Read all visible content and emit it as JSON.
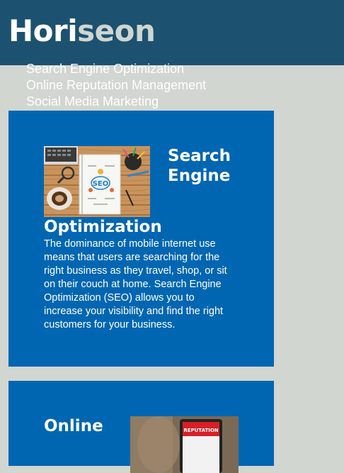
{
  "header": {
    "logo_part1": "Hori",
    "logo_part2": "seon"
  },
  "nav": {
    "items": [
      "Search Engine Optimization",
      "Online Reputation Management",
      "Social Media Marketing"
    ]
  },
  "sections": [
    {
      "title_line1": "Search Engine",
      "title_line2": "Optimization",
      "image_label": "SEO",
      "text": "The dominance of mobile internet use means that users are searching for the right business as they travel, shop, or sit on their couch at home. Search Engine Optimization (SEO) allows you to increase your visibility and find the right customers for your business."
    },
    {
      "title_line1": "Online",
      "image_label": "REPUTATION"
    }
  ],
  "colors": {
    "header_bg": "#1c5170",
    "page_bg": "#d2d6d0",
    "card_bg": "#0166b2"
  }
}
